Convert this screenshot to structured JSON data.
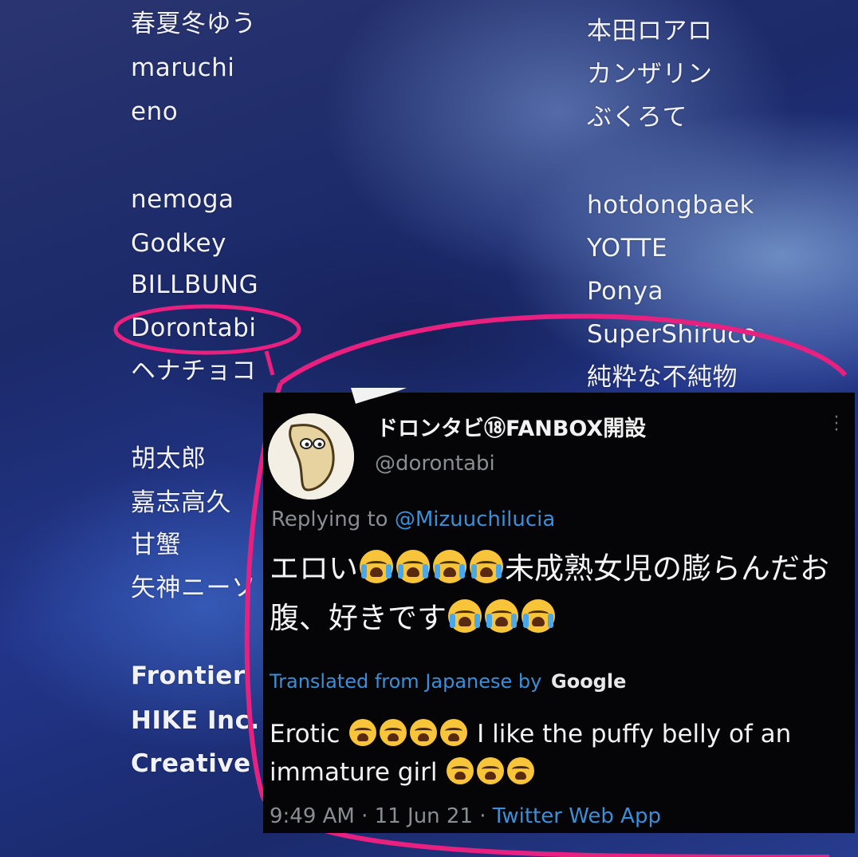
{
  "credits": {
    "left": [
      "春夏冬ゆう",
      "maruchi",
      "eno",
      "nemoga",
      "Godkey",
      "BILLBUNG",
      "Dorontabi",
      "ヘナチョコ",
      "胡太郎",
      "嘉志高久",
      "甘蟹",
      "矢神ニーソ",
      "Frontier",
      "HIKE Inc.",
      "Creative"
    ],
    "right": [
      "本田ロアロ",
      "カンザリン",
      "ぶくろて",
      "hotdongbaek",
      "YOTTE",
      "Ponya",
      "SuperShiruco",
      "純粋な不純物"
    ]
  },
  "tweet": {
    "display_name": "ドロンタビ⑱FANBOX開設",
    "handle": "@dorontabi",
    "reply_prefix": "Replying to",
    "reply_to": "@Mizuuchilucia",
    "body_part1": "エロい",
    "body_part2": "未成熟女児の膨らんだお腹、好きです",
    "translated_label": "Translated from Japanese by",
    "translated_provider": "Google",
    "translation_part1": "Erotic",
    "translation_part2": "I like the puffy belly of an immature girl",
    "time": "9:49 AM",
    "date": "11 Jun 21",
    "source": "Twitter Web App",
    "emoji_name": "loudly-crying-face"
  },
  "colors": {
    "highlight_ring": "#e8207f",
    "link": "#3a8fd8",
    "tweet_bg": "#050507"
  }
}
